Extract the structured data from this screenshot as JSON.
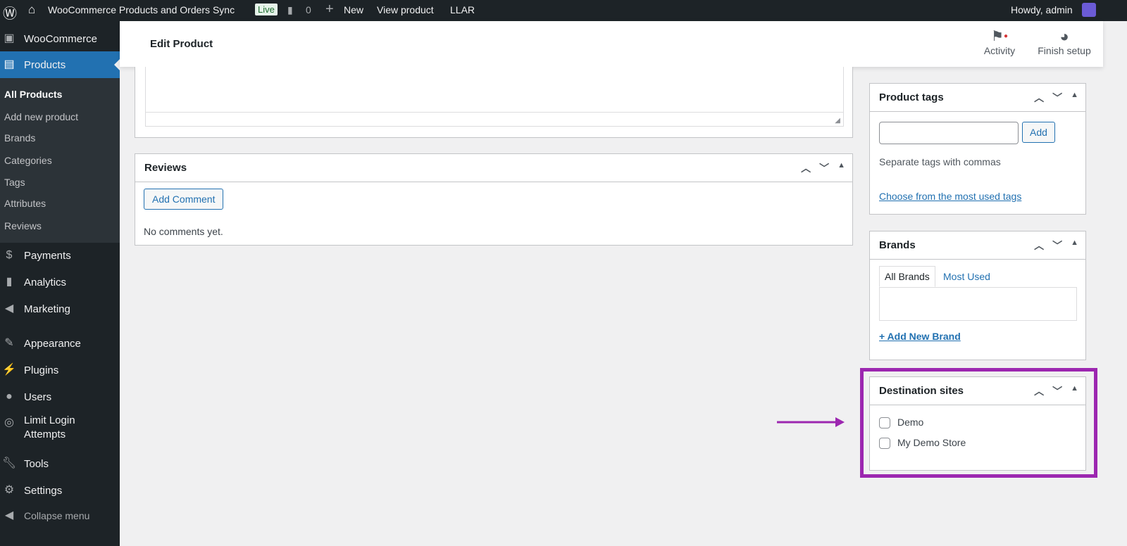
{
  "adminbar": {
    "site_name": "WooCommerce Products and Orders Sync",
    "live_badge": "Live",
    "comments": "0",
    "new": "New",
    "view_product": "View product",
    "llar": "LLAR",
    "howdy": "Howdy, admin"
  },
  "sidebar": {
    "woocommerce": "WooCommerce",
    "products": "Products",
    "submenu": [
      "All Products",
      "Add new product",
      "Brands",
      "Categories",
      "Tags",
      "Attributes",
      "Reviews"
    ],
    "payments": "Payments",
    "analytics": "Analytics",
    "marketing": "Marketing",
    "appearance": "Appearance",
    "plugins": "Plugins",
    "users": "Users",
    "limit_login_1": "Limit Login",
    "limit_login_2": "Attempts",
    "tools": "Tools",
    "settings": "Settings",
    "collapse": "Collapse menu"
  },
  "header": {
    "title": "Edit Product",
    "activity": "Activity",
    "finish_setup": "Finish setup"
  },
  "reviews": {
    "title": "Reviews",
    "add_comment": "Add Comment",
    "empty": "No comments yet."
  },
  "product_tags": {
    "title": "Product tags",
    "tag_input_value": "",
    "add": "Add",
    "hint": "Separate tags with commas",
    "choose": "Choose from the most used tags"
  },
  "brands": {
    "title": "Brands",
    "tab_all": "All Brands",
    "tab_most_used": "Most Used",
    "add_new": "+ Add New Brand"
  },
  "destination_sites": {
    "title": "Destination sites",
    "sites": [
      {
        "label": "Demo",
        "checked": false
      },
      {
        "label": "My Demo Store",
        "checked": false
      }
    ]
  },
  "highlight_color": "#9c27b0"
}
